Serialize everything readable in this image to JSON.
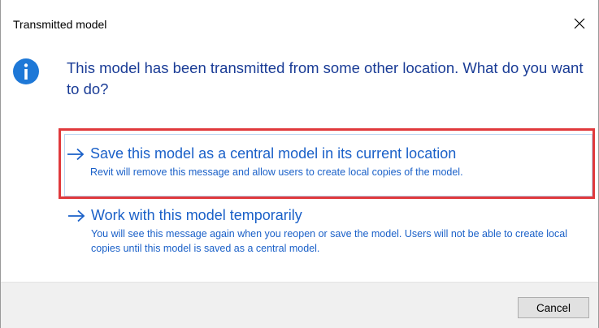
{
  "window": {
    "title": "Transmitted model"
  },
  "instruction": "This model has been transmitted from some other location. What do you want to do?",
  "options": [
    {
      "title": "Save this model as a central model in its current location",
      "description": "Revit will remove this message and allow users to create local copies of the model.",
      "highlighted": true
    },
    {
      "title": "Work with this model temporarily",
      "description": "You will see this message again when you reopen or save the model. Users will not be able to create local copies until this model is saved as a central model.",
      "highlighted": false
    }
  ],
  "footer": {
    "cancel_label": "Cancel"
  },
  "icons": {
    "info": "info-icon",
    "close": "close-icon",
    "arrow": "arrow-right-icon"
  },
  "colors": {
    "instruction_text": "#1a3c96",
    "link_text": "#1a60c8",
    "info_icon": "#1e78d7",
    "highlight_border": "#e0393c"
  }
}
